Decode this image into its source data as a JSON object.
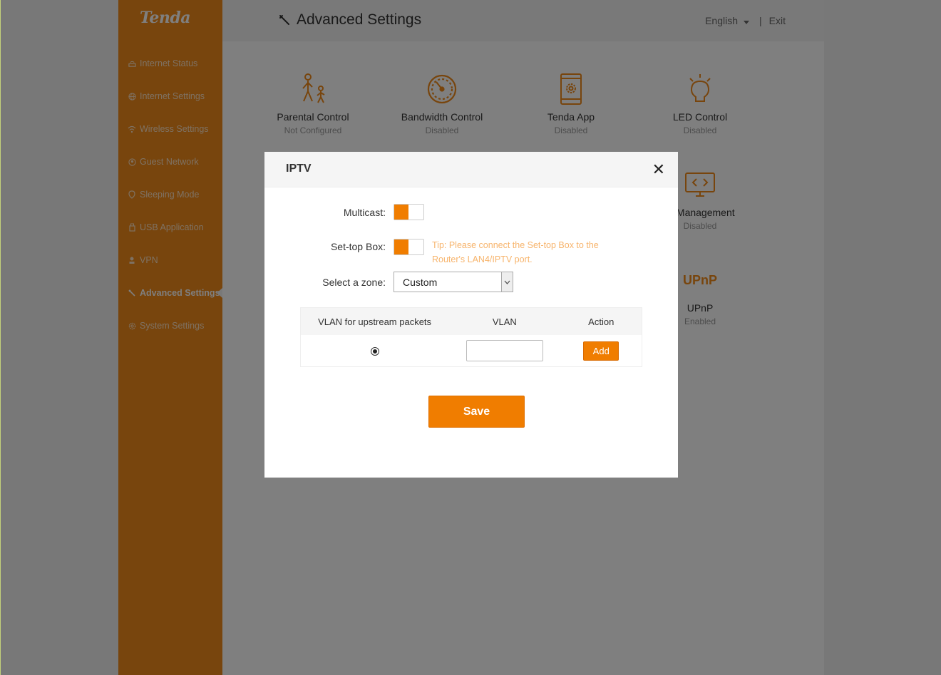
{
  "brand": {
    "logo": "Tenda",
    "accent": "#f08a1a"
  },
  "sidebar": {
    "items": [
      {
        "label": "Internet Status",
        "icon": "router-icon"
      },
      {
        "label": "Internet Settings",
        "icon": "globe-icon"
      },
      {
        "label": "Wireless Settings",
        "icon": "wifi-icon"
      },
      {
        "label": "Guest Network",
        "icon": "guest-icon"
      },
      {
        "label": "Sleeping Mode",
        "icon": "sleep-icon"
      },
      {
        "label": "USB Application",
        "icon": "usb-icon"
      },
      {
        "label": "VPN",
        "icon": "vpn-icon"
      },
      {
        "label": "Advanced Settings",
        "icon": "wrench-icon",
        "active": true
      },
      {
        "label": "System Settings",
        "icon": "gear-icon"
      }
    ]
  },
  "header": {
    "title": "Advanced Settings",
    "language": "English",
    "separator": "|",
    "exit": "Exit"
  },
  "tiles": [
    {
      "name": "Parental Control",
      "status": "Not Configured",
      "icon": "parent-child-icon"
    },
    {
      "name": "Bandwidth Control",
      "status": "Disabled",
      "icon": "speedometer-icon"
    },
    {
      "name": "Tenda App",
      "status": "Disabled",
      "icon": "phone-gear-icon"
    },
    {
      "name": "LED Control",
      "status": "Disabled",
      "icon": "bulb-icon"
    },
    {
      "name": "te Management",
      "status": "Disabled",
      "icon": "monitor-code-icon"
    },
    {
      "name": "UPnP",
      "status": "Enabled",
      "icon": "upnp-icon",
      "icon_text": "UPnP"
    }
  ],
  "modal": {
    "title": "IPTV",
    "close": "✕",
    "multicast_label": "Multicast:",
    "settop_label": "Set-top Box:",
    "tip": "Tip: Please connect the Set-top Box to the Router's LAN4/IPTV port.",
    "zone_label": "Select a zone:",
    "zone_value": "Custom",
    "table": {
      "headers": [
        "VLAN for upstream packets",
        "VLAN",
        "Action"
      ],
      "add_label": "Add",
      "vlan_value": ""
    },
    "save": "Save"
  }
}
